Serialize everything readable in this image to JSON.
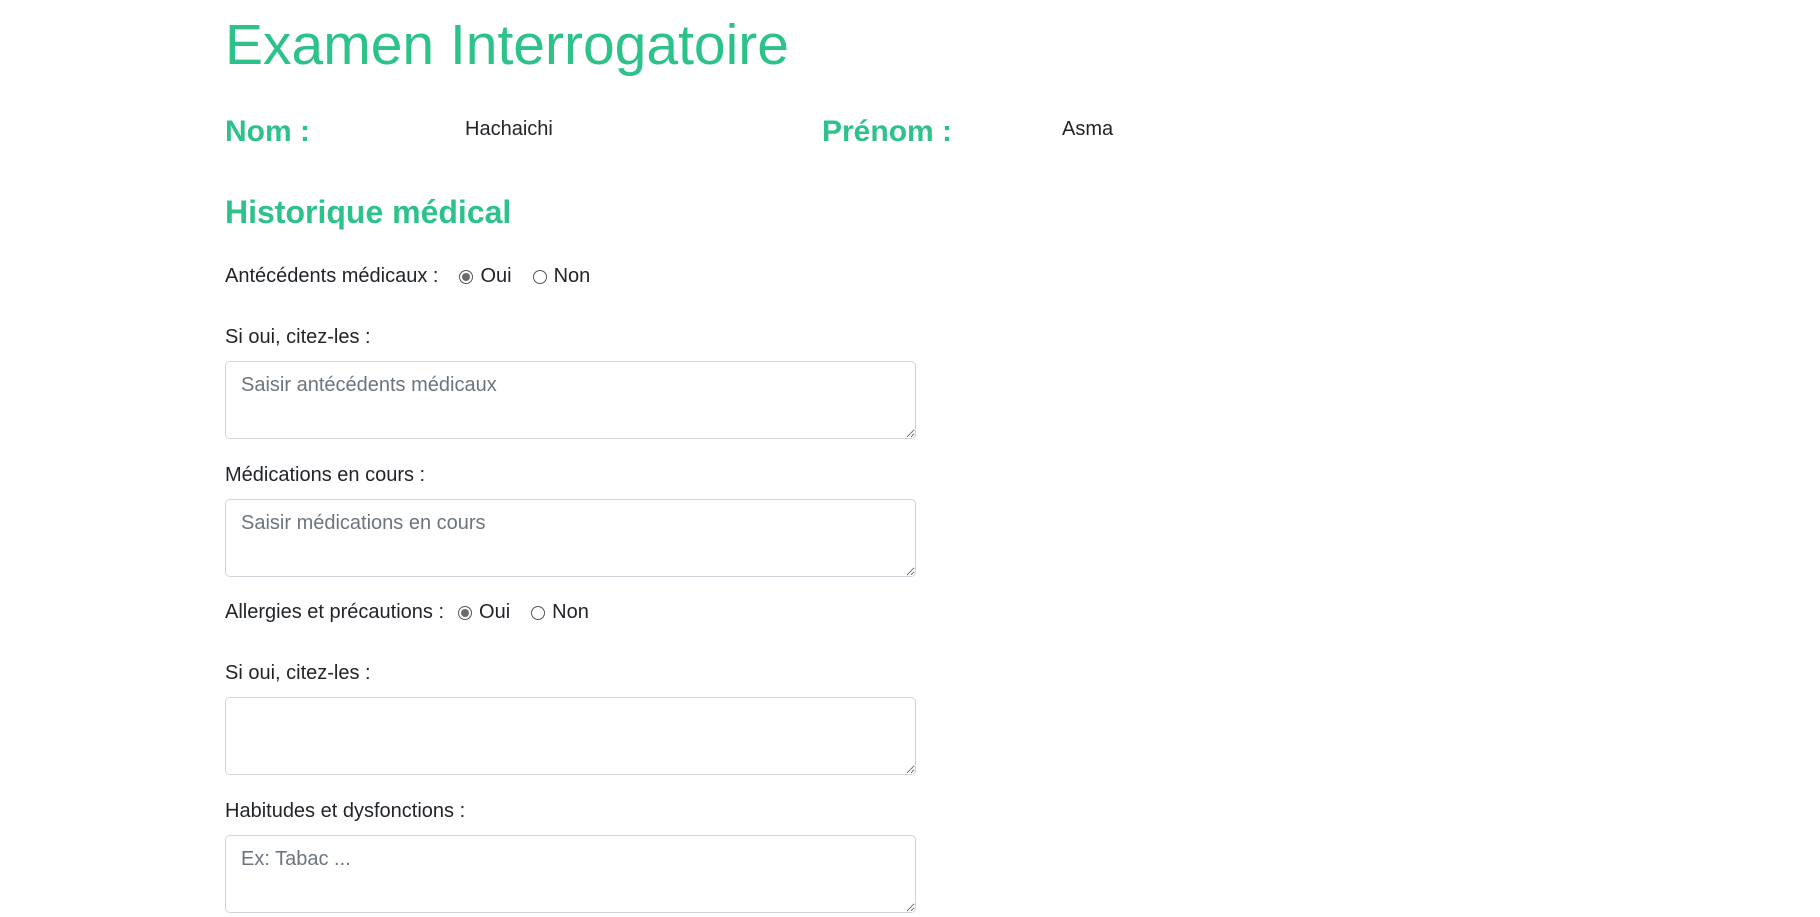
{
  "header": {
    "title": "Examen Interrogatoire"
  },
  "patient": {
    "nom_label": "Nom :",
    "nom_value": "Hachaichi",
    "prenom_label": "Prénom :",
    "prenom_value": "Asma"
  },
  "historique": {
    "section_title": "Historique médical",
    "antecedents": {
      "label": "Antécédents médicaux :",
      "option_yes": "Oui",
      "option_no": "Non",
      "selected": "Oui"
    },
    "antecedents_detail": {
      "label": "Si oui, citez-les :",
      "placeholder": "Saisir antécédents médicaux",
      "value": ""
    },
    "medications": {
      "label": "Médications en cours :",
      "placeholder": "Saisir médications en cours",
      "value": ""
    },
    "allergies": {
      "label": "Allergies et précautions :",
      "option_yes": "Oui",
      "option_no": "Non",
      "selected": "Oui"
    },
    "allergies_detail": {
      "label": "Si oui, citez-les :",
      "placeholder": "",
      "value": ""
    },
    "habitudes": {
      "label": "Habitudes et dysfonctions :",
      "placeholder": "Ex: Tabac ...",
      "value": ""
    }
  },
  "colors": {
    "accent": "#2cc28a",
    "text": "#212529",
    "placeholder": "#6c757d",
    "border": "#ced4da"
  }
}
